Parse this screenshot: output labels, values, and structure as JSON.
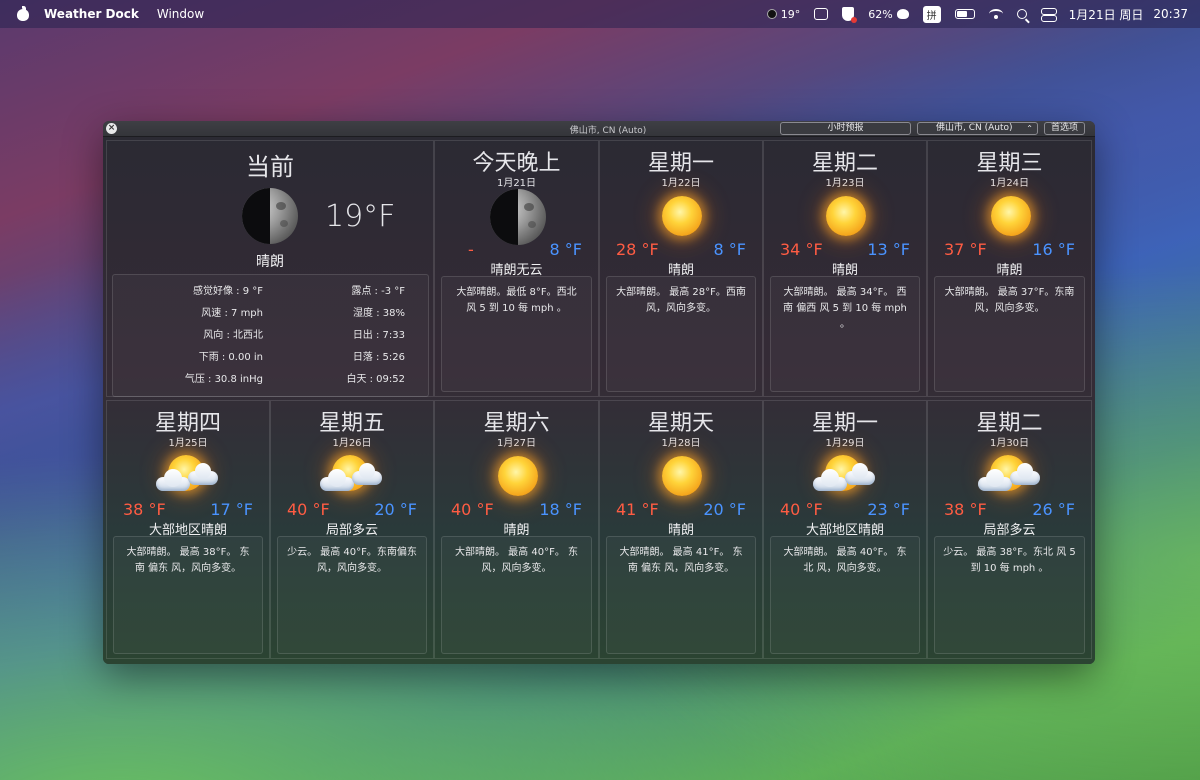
{
  "menubar": {
    "app_name": "Weather Dock",
    "menus": [
      "Window"
    ],
    "moon_temp": "19°",
    "battery_percent": "62%",
    "input_method": "拼",
    "date": "1月21日 周日",
    "time": "20:37"
  },
  "window": {
    "title": "佛山市, CN (Auto)",
    "close_label": "×",
    "hourly_button": "小时预报",
    "location_select": "佛山市, CN (Auto)",
    "prefs_button": "首选项"
  },
  "current": {
    "title": "当前",
    "temp": "19°F",
    "condition": "晴朗",
    "details_left": [
      "感觉好像 : 9 °F",
      "风速 : 7 mph",
      "风向 : 北西北",
      "下雨 : 0.00 in",
      "气压 : 30.8 inHg"
    ],
    "details_right": [
      "露点 : -3 °F",
      "湿度 : 38%",
      "日出 : 7:33",
      "日落 : 5:26",
      "白天 : 09:52"
    ]
  },
  "tonight": {
    "title": "今天晚上",
    "date": "1月21日",
    "high": "-",
    "low": "8 °F",
    "condition": "晴朗无云",
    "detail": "大部晴朗。最低 8°F。西北 风 5 到 10 每 mph 。"
  },
  "forecast": [
    {
      "title": "星期一",
      "date": "1月22日",
      "high": "28 °F",
      "low": "8 °F",
      "condition": "晴朗",
      "icon": "sun-icon",
      "detail": "大部晴朗。 最高 28°F。西南 风，风向多变。"
    },
    {
      "title": "星期二",
      "date": "1月23日",
      "high": "34 °F",
      "low": "13 °F",
      "condition": "晴朗",
      "icon": "sun-icon",
      "detail": "大部晴朗。 最高 34°F。 西南 偏西 风 5 到 10 每 mph 。"
    },
    {
      "title": "星期三",
      "date": "1月24日",
      "high": "37 °F",
      "low": "16 °F",
      "condition": "晴朗",
      "icon": "sun-icon",
      "detail": "大部晴朗。 最高 37°F。东南 风，风向多变。"
    },
    {
      "title": "星期四",
      "date": "1月25日",
      "high": "38 °F",
      "low": "17 °F",
      "condition": "大部地区晴朗",
      "icon": "partly-cloudy-icon",
      "detail": "大部晴朗。 最高 38°F。 东南 偏东 风，风向多变。"
    },
    {
      "title": "星期五",
      "date": "1月26日",
      "high": "40 °F",
      "low": "20 °F",
      "condition": "局部多云",
      "icon": "partly-cloudy-icon",
      "detail": "少云。 最高 40°F。东南偏东 风，风向多变。"
    },
    {
      "title": "星期六",
      "date": "1月27日",
      "high": "40 °F",
      "low": "18 °F",
      "condition": "晴朗",
      "icon": "sun-icon",
      "detail": "大部晴朗。 最高 40°F。 东 风，风向多变。"
    },
    {
      "title": "星期天",
      "date": "1月28日",
      "high": "41 °F",
      "low": "20 °F",
      "condition": "晴朗",
      "icon": "sun-icon",
      "detail": "大部晴朗。 最高 41°F。 东南 偏东 风，风向多变。"
    },
    {
      "title": "星期一",
      "date": "1月29日",
      "high": "40 °F",
      "low": "23 °F",
      "condition": "大部地区晴朗",
      "icon": "partly-cloudy-icon",
      "detail": "大部晴朗。 最高 40°F。 东北 风，风向多变。"
    },
    {
      "title": "星期二",
      "date": "1月30日",
      "high": "38 °F",
      "low": "26 °F",
      "condition": "局部多云",
      "icon": "partly-cloudy-icon",
      "detail": "少云。 最高 38°F。东北 风 5 到 10 每 mph 。"
    }
  ]
}
